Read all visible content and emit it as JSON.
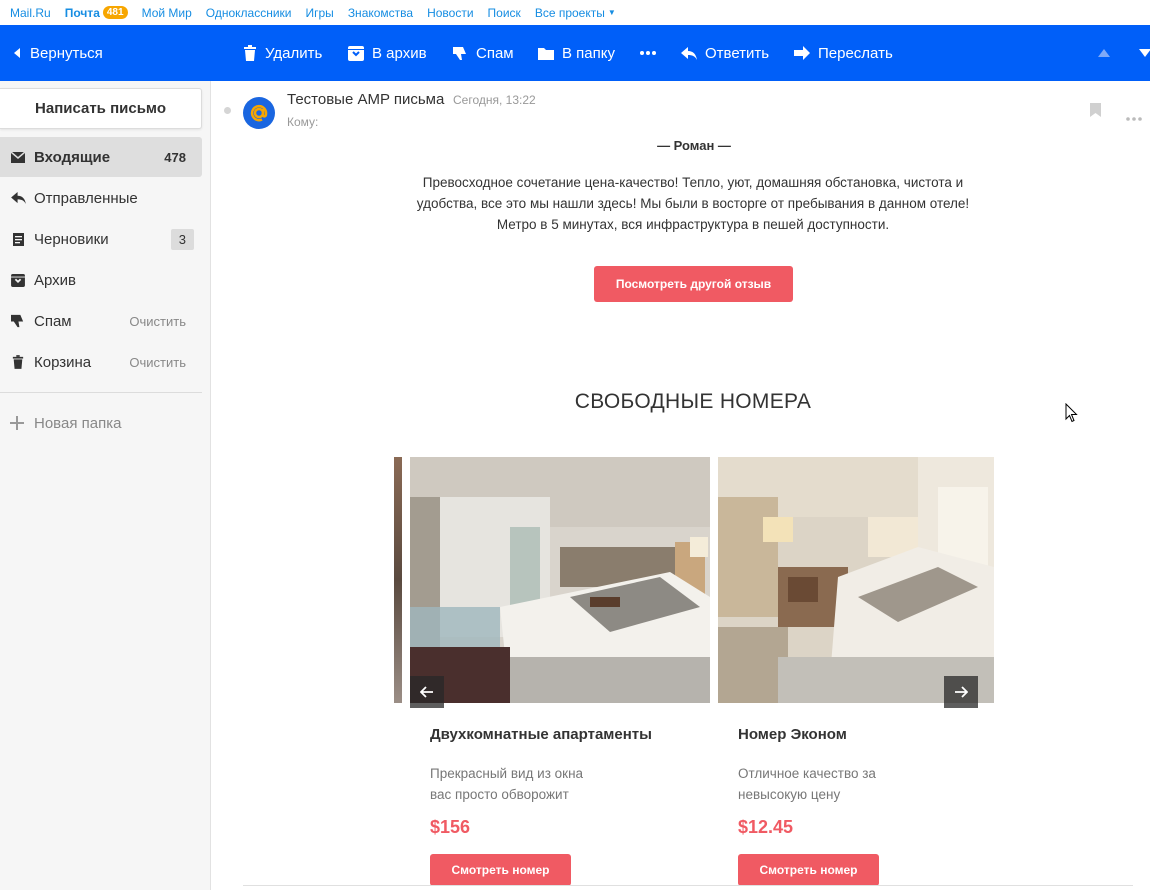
{
  "portal": {
    "links": [
      "Mail.Ru",
      "Почта",
      "Мой Мир",
      "Одноклассники",
      "Игры",
      "Знакомства",
      "Новости",
      "Поиск",
      "Все проекты"
    ],
    "mail_badge": "481"
  },
  "toolbar": {
    "back": "Вернуться",
    "delete": "Удалить",
    "archive": "В архив",
    "spam": "Спам",
    "to_folder": "В папку",
    "reply": "Ответить",
    "forward": "Переслать"
  },
  "sidebar": {
    "compose": "Написать письмо",
    "folders": [
      {
        "name": "Входящие",
        "count": "478",
        "icon": "envelope-icon"
      },
      {
        "name": "Отправленные",
        "icon": "reply-icon"
      },
      {
        "name": "Черновики",
        "count": "3",
        "icon": "draft-icon"
      },
      {
        "name": "Архив",
        "icon": "archive-icon"
      },
      {
        "name": "Спам",
        "action": "Очистить",
        "icon": "thumb-down-icon"
      },
      {
        "name": "Корзина",
        "action": "Очистить",
        "icon": "trash-icon"
      }
    ],
    "new_folder": "Новая папка"
  },
  "message": {
    "subject": "Тестовые AMP письма",
    "date": "Сегодня, 13:22",
    "to_label": "Кому:"
  },
  "content": {
    "author": "— Роман —",
    "review": "Превосходное сочетание цена-качество! Тепло, уют, домашняя обстановка, чистота и удобства, все это мы нашли здесь! Мы были в восторге от пребывания в данном отеле! Метро в 5 минутах, вся инфраструктура в пешей доступности.",
    "cta": "Посмотреть другой отзыв",
    "section_title": "СВОБОДНЫЕ НОМЕРА",
    "rooms": [
      {
        "title": "Двухкомнатные апартаменты",
        "desc_line1": "Прекрасный вид из окна",
        "desc_line2": "вас просто обворожит",
        "price": "$156",
        "button": "Смотреть номер"
      },
      {
        "title": "Номер Эконом",
        "desc_line1": "Отличное качество за",
        "desc_line2": "невысокую цену",
        "price": "$12.45",
        "button": "Смотреть номер"
      }
    ]
  },
  "colors": {
    "toolbar_bg": "#005ff9",
    "accent_red": "#f05a63",
    "link_blue": "#168de2",
    "badge_orange": "#f7a600"
  }
}
